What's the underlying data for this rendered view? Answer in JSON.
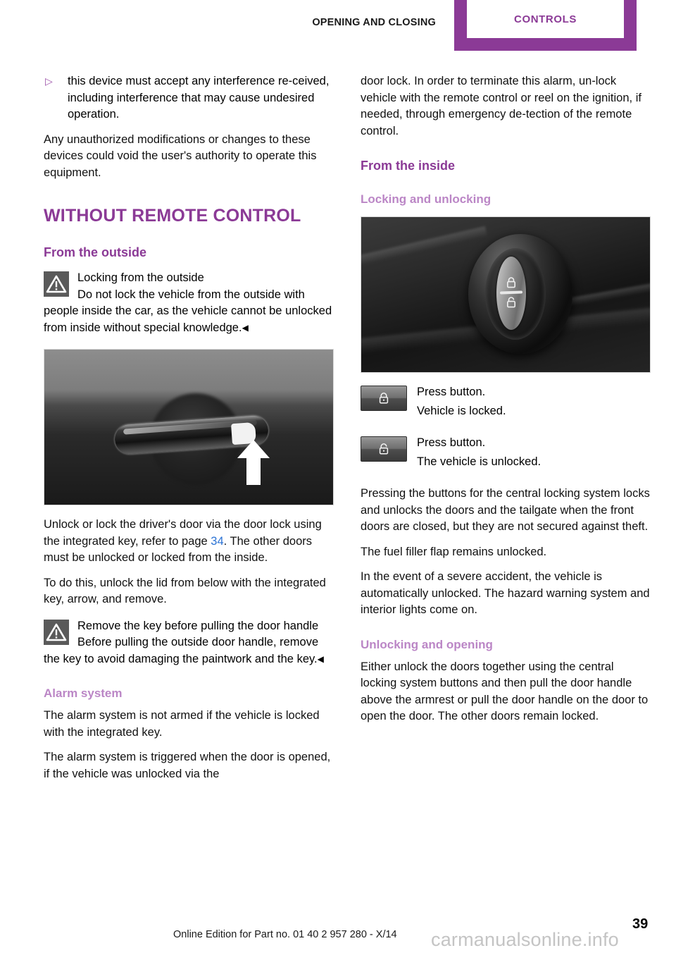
{
  "header": {
    "chapter_label": "Opening and closing",
    "tab_label": "Controls",
    "accent_color": "#8b3a96"
  },
  "left_column": {
    "bullet": {
      "glyph": "▷",
      "text": "this device must accept any interference re-ceived, including interference that may cause undesired operation."
    },
    "para_authority": "Any unauthorized modifications or changes to these devices could void the user's authority to operate this equipment.",
    "section_title": "Without remote control",
    "subsection_title": "From the outside",
    "warning_outside": {
      "icon": "warning-triangle-icon",
      "heading": "Locking from the outside",
      "body": "Do not lock the vehicle from the outside with people inside the car, as the vehicle cannot be unlocked from inside without special knowledge.",
      "endmark": "◀"
    },
    "figure_door_handle": {
      "icon": "door-handle-photo",
      "arrow": "up-arrow-callout"
    },
    "para_unlock_lock": {
      "before_link": "Unlock or lock the driver's door via the door lock using the integrated key, refer to page ",
      "link": "34",
      "after_link": "."
    },
    "para_other_doors": "The other doors must be unlocked or locked from the inside.",
    "para_todo": "To do this, unlock the lid from below with the integrated key, arrow, and remove.",
    "warning_remove_key": {
      "icon": "warning-triangle-icon",
      "heading": "Remove the key before pulling the door handle",
      "body": "Before pulling the outside door handle, remove the key to avoid damaging the paintwork and the key.",
      "endmark": "◀"
    },
    "alarm_heading": "Alarm system",
    "alarm_para_1": "The alarm system is not armed if the vehicle is locked with the integrated key.",
    "alarm_para_2": "The alarm system is triggered when the door is opened, if the vehicle was unlocked via the"
  },
  "right_column": {
    "para_continued": "door lock. In order to terminate this alarm, un-lock vehicle with the remote control or reel on the ignition, if needed, through emergency de-tection of the remote control.",
    "subsection_title": "From the inside",
    "locking_heading": "Locking and unlocking",
    "figure_door_panel": {
      "icon": "central-locking-button-photo"
    },
    "steps": [
      {
        "icon": "lock-closed-icon",
        "lines": [
          "Press button.",
          "Vehicle is locked."
        ]
      },
      {
        "icon": "lock-open-icon",
        "lines": [
          "Press button.",
          "The vehicle is unlocked."
        ]
      }
    ],
    "para_pressing": "Pressing the buttons for the central locking system locks and unlocks the doors and the tailgate when the front doors are closed, but they are not secured against theft.",
    "para_fuel_flap": "The fuel filler flap remains unlocked.",
    "para_accident": "In the event of a severe accident, the vehicle is automatically unlocked. The hazard warning system and interior lights come on.",
    "unlocking_heading": "Unlocking and opening",
    "para_either": "Either unlock the doors together using the central locking system buttons and then pull the door handle above the armrest or pull the door handle on the door to open the door. The other doors remain locked."
  },
  "footer": {
    "edition_text": "Online Edition for Part no. 01 40 2 957 280 - X/14",
    "page_number": "39",
    "watermark": "carmanualsonline.info"
  }
}
